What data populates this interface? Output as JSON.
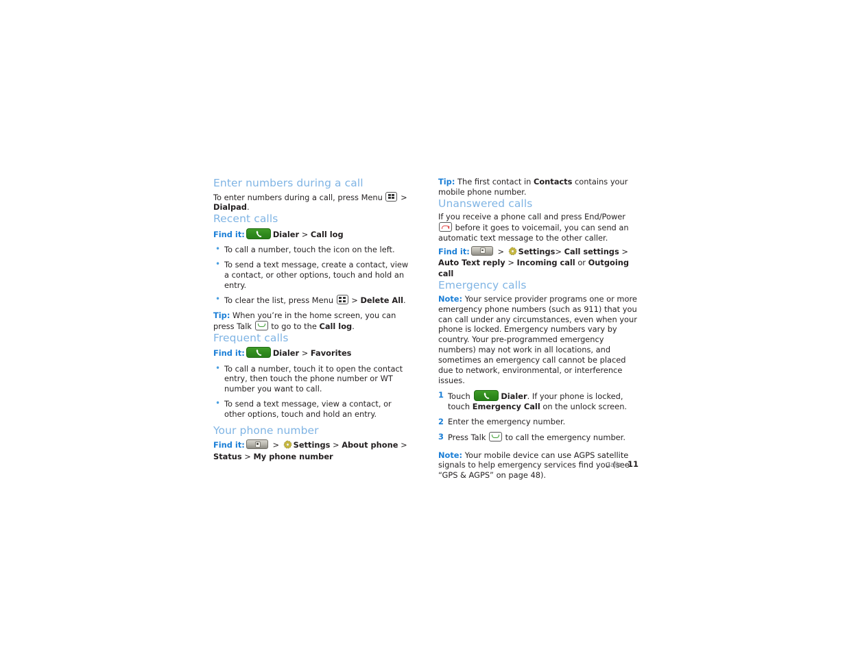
{
  "document": {
    "type": "phone-user-guide-page",
    "page_number": "11",
    "footer_section": "Calls"
  },
  "colors": {
    "heading": "#7fb4e4",
    "findit_label": "#1a7ed6",
    "bullet": "#4a9fe0",
    "body_text": "#231f20",
    "dialer_green": "#2f8a1d",
    "end_key_red": "#e04b4b",
    "talk_key_green": "#3a9b2e",
    "gear_yellow": "#c8b93e",
    "footer_gray": "#6d6e71"
  },
  "left_column": {
    "sections": [
      {
        "id": "enter-numbers-during-a-call",
        "heading": "Enter numbers during a call",
        "paragraph_part1": "To enter numbers during a call, press Menu ",
        "paragraph_sep": " > ",
        "paragraph_bold": "Dialpad",
        "paragraph_end": ".",
        "icon": "menu-key-icon"
      },
      {
        "id": "recent-calls",
        "heading": "Recent calls",
        "findit": {
          "label": "Find it:",
          "icon": "dialer-icon",
          "item1": "Dialer",
          "sep1": " > ",
          "item2": "Call log"
        },
        "bullets": [
          "To call a number, touch the icon on the left.",
          "To send a text message, create a contact, view a contact, or other options, touch and hold an entry."
        ],
        "bullet3": {
          "pre": "To clear the list, press Menu ",
          "icon": "menu-key-icon",
          "sep": " > ",
          "bold": "Delete All",
          "post": "."
        },
        "tip": {
          "label": "Tip:",
          "pre": " When you’re in the home screen, you can press Talk ",
          "icon": "talk-key-icon",
          "mid": " to go to the ",
          "bold": "Call log",
          "post": "."
        }
      },
      {
        "id": "frequent-calls",
        "heading": "Frequent calls",
        "findit": {
          "label": "Find it:",
          "icon": "dialer-icon",
          "item1": "Dialer",
          "sep1": " > ",
          "item2": "Favorites"
        },
        "bullets": [
          "To call a number, touch it to open the contact entry, then touch the phone number or WT number you want to call.",
          "To send a text message, view a contact, or other options, touch and hold an entry."
        ]
      },
      {
        "id": "your-phone-number",
        "heading": "Your phone number",
        "findit": {
          "label": "Find it:",
          "icon_home": "home-key-icon",
          "sep1": " > ",
          "icon_gear": "settings-gear-icon",
          "item1": "Settings",
          "sep2": " > ",
          "item2": "About phone",
          "sep3": " > ",
          "item3": "Status",
          "sep4": " > ",
          "item4": "My phone number"
        }
      }
    ]
  },
  "right_column": {
    "tip_top": {
      "label": "Tip:",
      "pre": " The first contact in ",
      "bold": "Contacts",
      "post": " contains your mobile phone number."
    },
    "sections": [
      {
        "id": "unanswered-calls",
        "heading": "Unanswered calls",
        "paragraph_pre": "If you receive a phone call and press End/Power ",
        "icon": "end-power-key-icon",
        "paragraph_post": " before it goes to voicemail, you can send an automatic text message to the other caller.",
        "findit": {
          "label": "Find it:",
          "icon_home": "home-key-icon",
          "sep1": " > ",
          "icon_gear": "settings-gear-icon",
          "item1": "Settings",
          "sep2": "> ",
          "item2": "Call settings",
          "sep3": " > ",
          "item3": "Auto Text reply",
          "sep4": " > ",
          "item4": "Incoming call",
          "sep5": " or ",
          "item5": "Outgoing call"
        }
      },
      {
        "id": "emergency-calls",
        "heading": "Emergency calls",
        "note": {
          "label": "Note:",
          "text": " Your service provider programs one or more emergency phone numbers (such as 911) that you can call under any circumstances, even when your phone is locked. Emergency numbers vary by country. Your pre-programmed emergency numbers) may not work in all locations, and sometimes an emergency call cannot be placed due to network, environmental, or interference issues."
        },
        "steps": [
          {
            "num": "1",
            "pre": "Touch ",
            "icon": "dialer-icon",
            "bold1": "Dialer",
            "mid": ". If your phone is locked, touch ",
            "bold2": "Emergency Call",
            "post": " on the unlock screen."
          },
          {
            "num": "2",
            "text": "Enter the emergency number."
          },
          {
            "num": "3",
            "pre": "Press Talk ",
            "icon": "talk-key-icon",
            "post": " to call the emergency number."
          }
        ],
        "note_bottom": {
          "label": "Note:",
          "text": " Your mobile device can use AGPS satellite signals to help emergency services find you (see “GPS & AGPS” on page 48)."
        }
      }
    ]
  }
}
